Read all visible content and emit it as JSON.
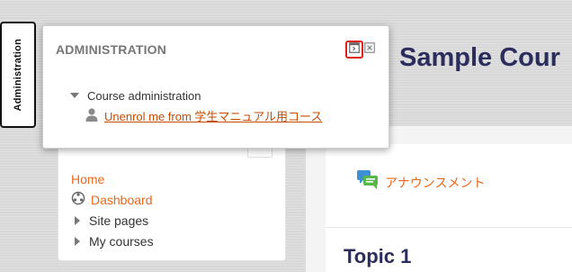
{
  "dock": {
    "tab_label": "Administration"
  },
  "course": {
    "title": "Sample Cour"
  },
  "main": {
    "announcement_label": "アナウンスメント",
    "topic_title": "Topic 1"
  },
  "navigation": {
    "items": [
      {
        "label": "Home"
      },
      {
        "label": "Dashboard"
      },
      {
        "label": "Site pages"
      },
      {
        "label": "My courses"
      }
    ]
  },
  "admin_block": {
    "title": "ADMINISTRATION",
    "tree": {
      "parent_label": "Course administration",
      "child_label": "Unenrol me from 学生マニュアル用コース"
    }
  },
  "colors": {
    "accent": "#e8681e",
    "heading": "#2b2d5c",
    "highlight": "#e0211b"
  },
  "icons": [
    "undock-icon",
    "close-icon",
    "user-icon",
    "dashboard-icon",
    "forum-icon",
    "chevron-right-icon",
    "chevron-down-icon"
  ]
}
